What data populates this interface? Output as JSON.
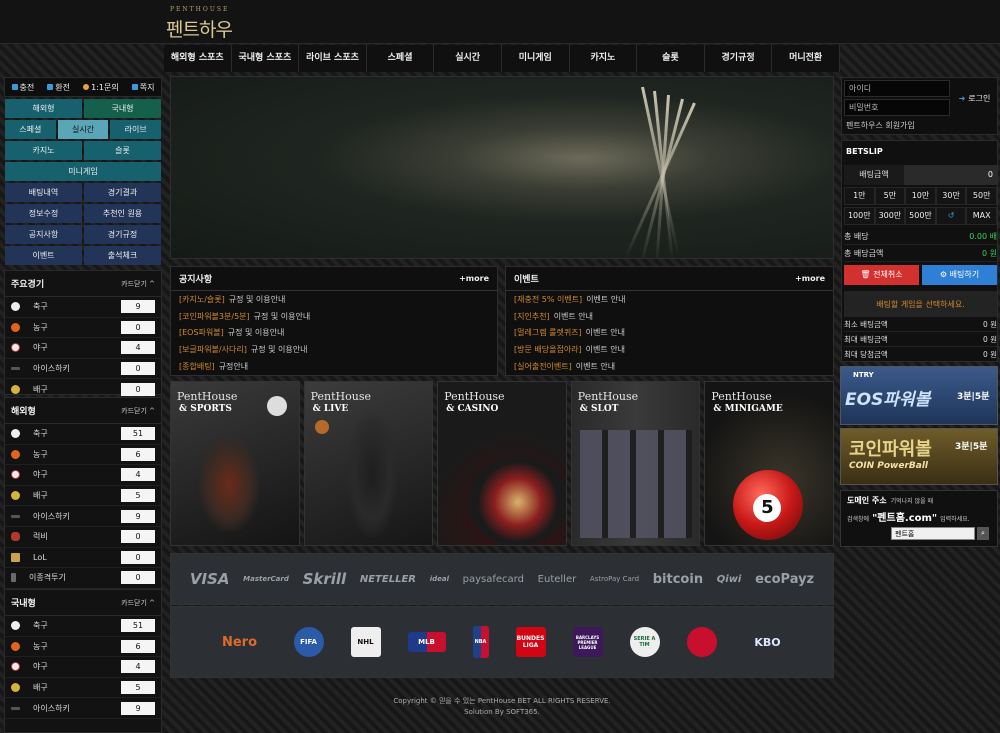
{
  "header": {
    "logo_tag": "PENTHOUSE",
    "logo_name": "펜트하우스"
  },
  "nav": [
    "해외형 스포츠",
    "국내형 스포츠",
    "라이브 스포츠",
    "스페셜",
    "실시간",
    "미니게임",
    "카지노",
    "슬롯",
    "경기규정",
    "머니전환"
  ],
  "quick": {
    "charge": "충전",
    "exchange": "환전",
    "inquiry": "1:1문의",
    "note": "쪽지"
  },
  "categories": {
    "row1": [
      "해외형",
      "국내형"
    ],
    "row2": [
      "스페셜",
      "실시간",
      "라이브"
    ],
    "row3": [
      "카지노",
      "슬롯"
    ],
    "row4": "미니게임",
    "row5": [
      "배팅내역",
      "경기결과"
    ],
    "row6": [
      "정보수정",
      "추천인 원용"
    ],
    "row7": [
      "공지사항",
      "경기규정"
    ],
    "row8": [
      "이벤트",
      "출석체크"
    ]
  },
  "main_games": {
    "title": "주요경기",
    "collapse": "카드닫기 ^",
    "items": [
      {
        "name": "축구",
        "count": "9"
      },
      {
        "name": "농구",
        "count": "0"
      },
      {
        "name": "야구",
        "count": "4"
      },
      {
        "name": "아이스하키",
        "count": "0"
      },
      {
        "name": "배구",
        "count": "0"
      }
    ]
  },
  "overseas": {
    "title": "해외형",
    "collapse": "카드닫기 ^",
    "items": [
      {
        "name": "축구",
        "count": "51"
      },
      {
        "name": "농구",
        "count": "6"
      },
      {
        "name": "야구",
        "count": "4"
      },
      {
        "name": "배구",
        "count": "5"
      },
      {
        "name": "아이스하키",
        "count": "9"
      },
      {
        "name": "럭비",
        "count": "0"
      },
      {
        "name": "LoL",
        "count": "0"
      },
      {
        "name": "이종격투기",
        "count": "0"
      }
    ]
  },
  "domestic": {
    "title": "국내형",
    "collapse": "카드닫기 ^",
    "items": [
      {
        "name": "축구",
        "count": "51"
      },
      {
        "name": "농구",
        "count": "6"
      },
      {
        "name": "야구",
        "count": "4"
      },
      {
        "name": "배구",
        "count": "5"
      },
      {
        "name": "아이스하키",
        "count": "9"
      }
    ]
  },
  "notice": {
    "title": "공지사항",
    "more": "+more",
    "items": [
      {
        "tag": "[카지노/슬롯]",
        "text": "규정 및 이용안내"
      },
      {
        "tag": "[코인파워볼3분/5분]",
        "text": "규정 및 이용안내"
      },
      {
        "tag": "[EOS파워볼]",
        "text": "규정 및 이용안내"
      },
      {
        "tag": "[보글파워볼/사다리]",
        "text": "규정 및 이용안내"
      },
      {
        "tag": "[종합배팅]",
        "text": "규정안내"
      }
    ]
  },
  "events": {
    "title": "이벤트",
    "more": "+more",
    "items": [
      {
        "tag": "[재충전 5% 이벤트]",
        "text": "이벤트 안내"
      },
      {
        "tag": "[지인추천]",
        "text": "이벤트 안내"
      },
      {
        "tag": "[멀레그렘 룰렛퀴즈]",
        "text": "이벤트 안내"
      },
      {
        "tag": "[방문 배당올접아라]",
        "text": "이벤트 안내"
      },
      {
        "tag": "[실어출전이벤트]",
        "text": "이벤트 안내"
      }
    ]
  },
  "games": [
    {
      "brand": "PentHouse",
      "name": "& SPORTS"
    },
    {
      "brand": "PentHouse",
      "name": "& LIVE"
    },
    {
      "brand": "PentHouse",
      "name": "& CASINO"
    },
    {
      "brand": "PentHouse",
      "name": "& SLOT"
    },
    {
      "brand": "PentHouse",
      "name": "& MINIGAME"
    }
  ],
  "payments": [
    "VISA",
    "MasterCard",
    "Skrill",
    "NETELLER",
    "ideal",
    "paysafecard",
    "Euteller",
    "AstroPay Card",
    "bitcoin",
    "Qiwi",
    "ecoPayz"
  ],
  "leagues": [
    "Nero",
    "FIFA",
    "NHL",
    "MLB",
    "NBA",
    "BUNDES LIGA",
    "BARCLAYS PREMIER LEAGUE",
    "SERIE A TIM",
    "",
    "KBO"
  ],
  "footer": {
    "line1": "Copyright © 믿을 수 있는 PentHouse BET ALL RIGHTS RESERVE.",
    "line2": "Solution By SOFT365."
  },
  "login": {
    "id_placeholder": "아이디",
    "pw_placeholder": "비밀번호",
    "button": "로그인",
    "join": "펜트하우스 회원가입"
  },
  "betslip": {
    "title": "BETSLIP",
    "amount_label": "배팅금액",
    "amount_value": "0",
    "chips1": [
      "1만",
      "5만",
      "10만",
      "30만",
      "50만"
    ],
    "chips2": [
      "100만",
      "300만",
      "500만",
      "",
      "MAX"
    ],
    "total_odds_label": "총 배당",
    "total_odds_value": "0.00 배",
    "total_amount_label": "총 배당금액",
    "total_amount_value": "0 원",
    "cancel": "전체취소",
    "bet": "배팅하기",
    "message": "배팅할 게임을 선택하세요.",
    "min_label": "최소 배팅금액",
    "min_value": "0 원",
    "max_label": "최대 배팅금액",
    "max_value": "0 원",
    "max_win_label": "최대 당첨금액",
    "max_win_value": "0 원"
  },
  "ad1": {
    "top": "NTRY",
    "main": "EOS파워볼",
    "side": "3분|5분"
  },
  "ad2": {
    "main": "코인파워볼",
    "sub": "COIN PowerBall",
    "side": "3분|5분"
  },
  "domain": {
    "title": "도메인 주소",
    "title_sub": "기억나지 않을 때",
    "search_pre": "검색창에",
    "search_word": "\"펜트홈.com\"",
    "search_post": "입력하세요.",
    "input_value": "펜트홈"
  },
  "colors": {
    "accent_orange": "#d08a2c",
    "odds_green": "#36d35a",
    "cancel_red": "#d33030",
    "bet_blue": "#2f7fd6"
  }
}
